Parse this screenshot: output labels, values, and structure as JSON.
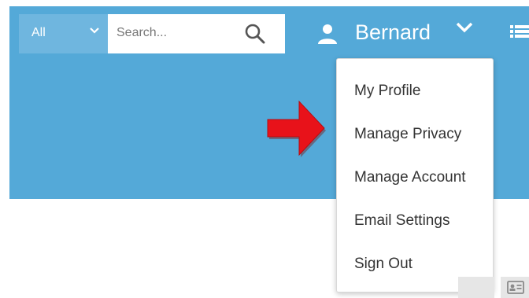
{
  "search": {
    "scope_label": "All",
    "placeholder": "Search...",
    "value": ""
  },
  "user": {
    "name": "Bernard"
  },
  "user_menu": {
    "items": [
      {
        "label": "My Profile"
      },
      {
        "label": "Manage Privacy"
      },
      {
        "label": "Manage Account"
      },
      {
        "label": "Email Settings"
      },
      {
        "label": "Sign Out"
      }
    ]
  },
  "icons": {
    "scope": "chevron-down-icon",
    "search": "magnifier-search-icon",
    "user": "user-silhouette-icon",
    "user_menu": "chevron-down-icon",
    "menu": "list-icon",
    "annotation": "red-arrow-icon",
    "corner": "id-card-icon"
  },
  "colors": {
    "header_bg": "#54a9d8",
    "scope_bg": "#6fb6df",
    "annotation_arrow": "#e8121a",
    "menu_text": "#333333"
  }
}
